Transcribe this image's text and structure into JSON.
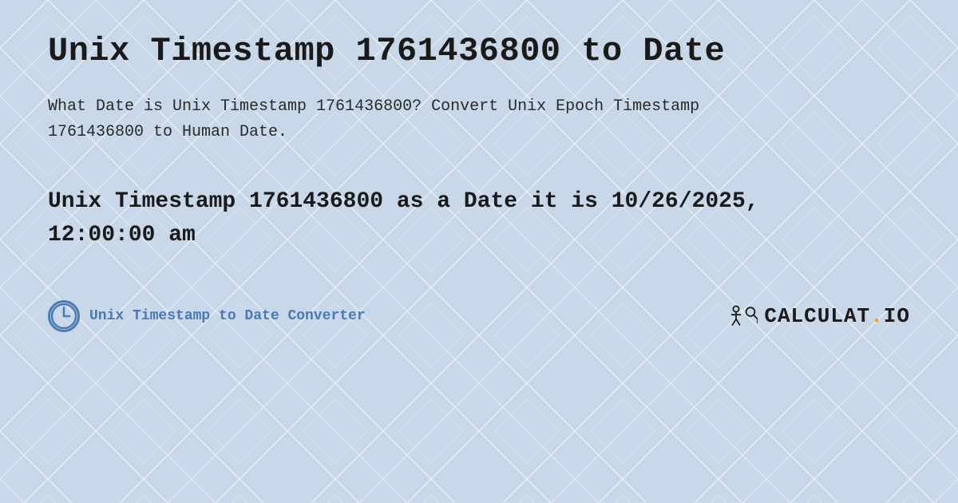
{
  "page": {
    "title": "Unix Timestamp 1761436800 to Date",
    "description": "What Date is Unix Timestamp 1761436800? Convert Unix Epoch Timestamp 1761436800 to Human Date.",
    "result": "Unix Timestamp 1761436800 as a Date it is 10/26/2025, 12:00:00 am",
    "footer_link_text": "Unix Timestamp to Date Converter",
    "logo_text": "CALCULAT.IO",
    "background_color": "#c8d8e8",
    "accent_color": "#4a7ab5"
  }
}
